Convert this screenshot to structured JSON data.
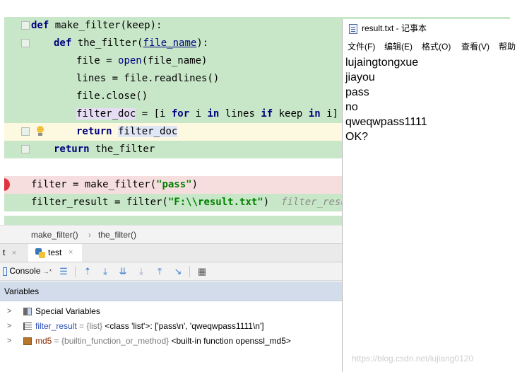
{
  "editor": {
    "lines": [
      {
        "tokens": [
          {
            "t": "def",
            "c": "kw"
          },
          {
            "t": " make_filter(keep):",
            "c": ""
          }
        ]
      },
      {
        "tokens": [
          {
            "t": "def",
            "c": "kw"
          },
          {
            "t": " the_filter(",
            "c": ""
          },
          {
            "t": "file_name",
            "c": "param"
          },
          {
            "t": "):",
            "c": ""
          }
        ]
      },
      {
        "tokens": [
          {
            "t": "file = ",
            "c": ""
          },
          {
            "t": "open",
            "c": "fn-call"
          },
          {
            "t": "(file_name)",
            "c": ""
          }
        ]
      },
      {
        "tokens": [
          {
            "t": "lines = file.readlines()",
            "c": ""
          }
        ]
      },
      {
        "tokens": [
          {
            "t": "file.close()",
            "c": ""
          }
        ]
      },
      {
        "tokens": [
          {
            "t": "filter_doc",
            "c": "hl"
          },
          {
            "t": " = [i ",
            "c": ""
          },
          {
            "t": "for",
            "c": "kw"
          },
          {
            "t": " i ",
            "c": ""
          },
          {
            "t": "in",
            "c": "kw"
          },
          {
            "t": " lines ",
            "c": ""
          },
          {
            "t": "if",
            "c": "kw"
          },
          {
            "t": " keep ",
            "c": ""
          },
          {
            "t": "in",
            "c": "kw"
          },
          {
            "t": " i]",
            "c": ""
          }
        ]
      },
      {
        "tokens": [
          {
            "t": "return",
            "c": "kw"
          },
          {
            "t": " ",
            "c": ""
          },
          {
            "t": "filter_doc",
            "c": "hl-blue"
          }
        ]
      },
      {
        "tokens": [
          {
            "t": "return",
            "c": "kw"
          },
          {
            "t": " the_filter",
            "c": ""
          }
        ]
      },
      {
        "tokens": []
      },
      {
        "tokens": [
          {
            "t": "filter = make_filter(",
            "c": ""
          },
          {
            "t": "\"pass\"",
            "c": "str"
          },
          {
            "t": ")",
            "c": ""
          }
        ]
      },
      {
        "tokens": [
          {
            "t": "filter_result = filter(",
            "c": ""
          },
          {
            "t": "\"F:\\\\result.txt\"",
            "c": "str"
          },
          {
            "t": ")  ",
            "c": ""
          },
          {
            "t": "filter_resu",
            "c": "hint"
          }
        ]
      }
    ]
  },
  "breadcrumb": {
    "items": [
      "make_filter()",
      "the_filter()"
    ],
    "separator": "›"
  },
  "debug_tabs": {
    "partial_tab": "t",
    "tab_test": "test",
    "close_glyph": "×"
  },
  "toolbar": {
    "console_label": "Console",
    "console_suffix": "→*"
  },
  "variables": {
    "header": "Variables",
    "rows": [
      {
        "name": "Special Variables",
        "type": "",
        "value": "",
        "icon": "special-variables-icon"
      },
      {
        "name": "filter_result",
        "type": " = {list} ",
        "value": "<class 'list'>: ['pass\\n', 'qweqwpass1111\\n']",
        "icon": "list-icon"
      },
      {
        "name": "md5",
        "type": " = {builtin_function_or_method} ",
        "value": "<built-in function openssl_md5>",
        "icon": "function-icon"
      }
    ]
  },
  "notepad": {
    "title": "result.txt - 记事本",
    "menu": [
      "文件(F)",
      "编辑(E)",
      "格式(O)",
      "查看(V)",
      "帮助"
    ],
    "lines": [
      "lujaingtongxue",
      "jiayou",
      "pass",
      "no",
      "qweqwpass1111",
      "OK?"
    ]
  },
  "watermark": "https://blog.csdn.net/lujiang0120"
}
